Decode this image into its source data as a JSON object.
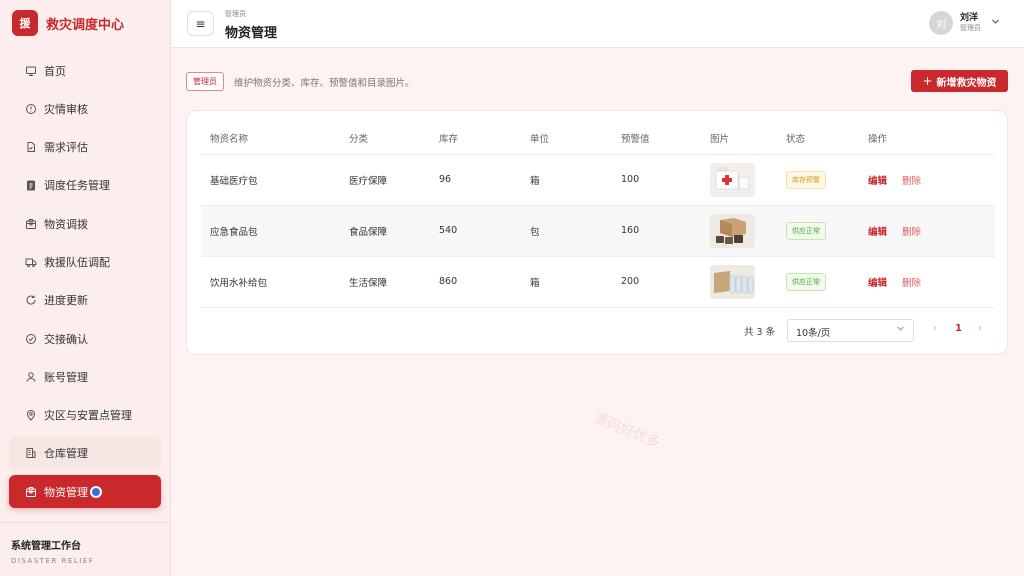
{
  "brand": {
    "logo": "援",
    "title": "救灾调度中心"
  },
  "nav": [
    {
      "label": "首页",
      "icon": "monitor-icon"
    },
    {
      "label": "灾情审核",
      "icon": "alert-circle-icon"
    },
    {
      "label": "需求评估",
      "icon": "file-check-icon"
    },
    {
      "label": "调度任务管理",
      "icon": "clipboard-icon"
    },
    {
      "label": "物资调拨",
      "icon": "package-icon"
    },
    {
      "label": "救援队伍调配",
      "icon": "truck-icon"
    },
    {
      "label": "进度更新",
      "icon": "refresh-icon"
    },
    {
      "label": "交接确认",
      "icon": "check-circle-icon"
    },
    {
      "label": "账号管理",
      "icon": "user-icon"
    },
    {
      "label": "灾区与安置点管理",
      "icon": "map-pin-icon"
    },
    {
      "label": "仓库管理",
      "icon": "building-icon"
    },
    {
      "label": "物资管理",
      "icon": "package-icon"
    }
  ],
  "sidebar_footer": {
    "title": "系统管理工作台",
    "subtitle": "DISASTER RELIEF"
  },
  "header": {
    "role_small": "管理员",
    "page_title": "物资管理"
  },
  "user": {
    "avatar": "刘",
    "name": "刘洋",
    "role": "管理员"
  },
  "toolbar": {
    "role_tag": "管理员",
    "description": "维护物资分类、库存、预警值和目录图片。",
    "add_button": "新增救灾物资"
  },
  "table": {
    "headers": [
      "物资名称",
      "分类",
      "库存",
      "单位",
      "预警值",
      "图片",
      "状态",
      "操作"
    ],
    "rows": [
      {
        "name": "基础医疗包",
        "category": "医疗保障",
        "stock": "96",
        "unit": "箱",
        "threshold": "100",
        "status": "库存预警",
        "edit": "编辑",
        "delete": "删除"
      },
      {
        "name": "应急食品包",
        "category": "食品保障",
        "stock": "540",
        "unit": "包",
        "threshold": "160",
        "status": "供应正常",
        "edit": "编辑",
        "delete": "删除"
      },
      {
        "name": "饮用水补给包",
        "category": "生活保障",
        "stock": "860",
        "unit": "箱",
        "threshold": "200",
        "status": "供应正常",
        "edit": "编辑",
        "delete": "删除"
      }
    ]
  },
  "pagination": {
    "total": "共 3 条",
    "page_size": "10条/页",
    "current_page": "1"
  },
  "watermark": "源码好优多",
  "colors": {
    "accent": "#c9282d",
    "warn": "#d79a1a",
    "ok": "#4caa3e"
  }
}
